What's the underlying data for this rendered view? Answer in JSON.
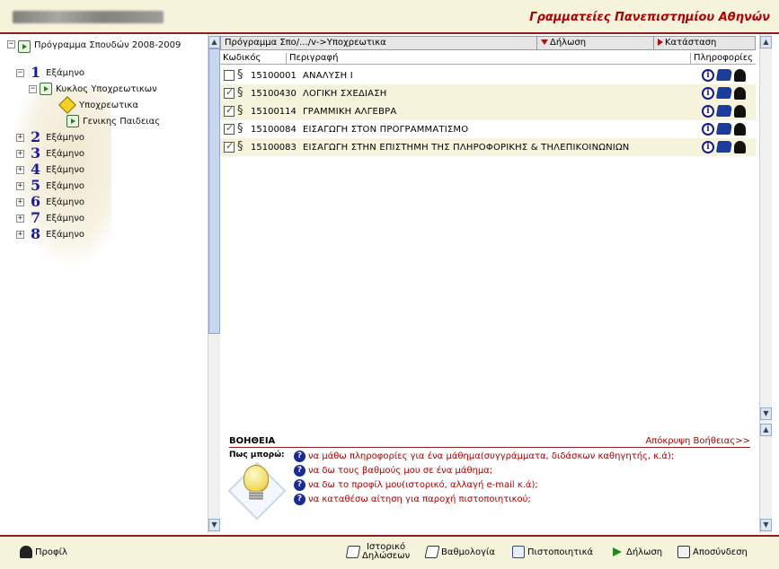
{
  "header": {
    "title": "Γραμματείες Πανεπιστημίου Αθηνών"
  },
  "tree": {
    "root": "Πρόγραμμα Σπουδών 2008-2009",
    "semesters": [
      {
        "num": "1",
        "label": "Εξάμηνο",
        "expanded": true
      },
      {
        "num": "2",
        "label": "Εξάμηνο"
      },
      {
        "num": "3",
        "label": "Εξάμηνο"
      },
      {
        "num": "4",
        "label": "Εξάμηνο"
      },
      {
        "num": "5",
        "label": "Εξάμηνο"
      },
      {
        "num": "6",
        "label": "Εξάμηνο"
      },
      {
        "num": "7",
        "label": "Εξάμηνο"
      },
      {
        "num": "8",
        "label": "Εξάμηνο"
      }
    ],
    "cycle": "Κυκλος Υποχρεωτικων",
    "leaf1": "Υποχρεωτικα",
    "leaf2": "Γενικης Παιδειας"
  },
  "pathbar": {
    "path": "Πρόγραμμα Σπο/.../v->Υποχρεωτικα",
    "declaration": "Δήλωση",
    "status": "Κατάσταση"
  },
  "columns": {
    "code": "Κωδικός",
    "description": "Περιγραφή",
    "info": "Πληροφορίες"
  },
  "courses": [
    {
      "code": "15100001",
      "title": "ΑΝΑΛΥΣΗ Ι",
      "checked": false
    },
    {
      "code": "15100430",
      "title": "ΛΟΓΙΚΗ ΣΧΕΔΙΑΣΗ",
      "checked": true
    },
    {
      "code": "15100114",
      "title": "ΓΡΑΜΜΙΚΗ ΑΛΓΕΒΡΑ",
      "checked": true
    },
    {
      "code": "15100084",
      "title": "ΕΙΣΑΓΩΓΗ ΣΤΟΝ ΠΡΟΓΡΑΜΜΑΤΙΣΜΟ",
      "checked": true
    },
    {
      "code": "15100083",
      "title": "ΕΙΣΑΓΩΓΗ ΣΤΗΝ ΕΠΙΣΤΗΜΗ ΤΗΣ ΠΛΗΡΟΦΟΡΙΚΗΣ & ΤΗΛΕΠΙΚΟΙΝΩΝΙΩΝ",
      "checked": true
    }
  ],
  "help": {
    "title": "ΒΟΗΘΕΙΑ",
    "hide": "Απόκρυψη Βοήθειας>>",
    "how": "Πως μπορώ:",
    "items": [
      "να μάθω πληροφορίες για ένα μάθημα(συγγράμματα, διδάσκων καθηγητής, κ.ά);",
      "να δω τους βαθμούς μου σε ένα μάθημα;",
      "να δω το προφίλ μου(ιστορικό, αλλαγή e-mail κ.ά);",
      "να καταθέσω αίτηση για παροχή πιστοποιητικού;"
    ]
  },
  "footer": {
    "profile": "Προφίλ",
    "history_line1": "Ιστορικό",
    "history_line2": "Δηλώσεων",
    "grades": "Βαθμολογία",
    "certificates": "Πιστοποιητικά",
    "declaration": "Δήλωση",
    "logout": "Αποσύνδεση"
  },
  "colors": {
    "accent": "#b00000",
    "band": "#f6f3dc",
    "border": "#8a1f1f"
  }
}
